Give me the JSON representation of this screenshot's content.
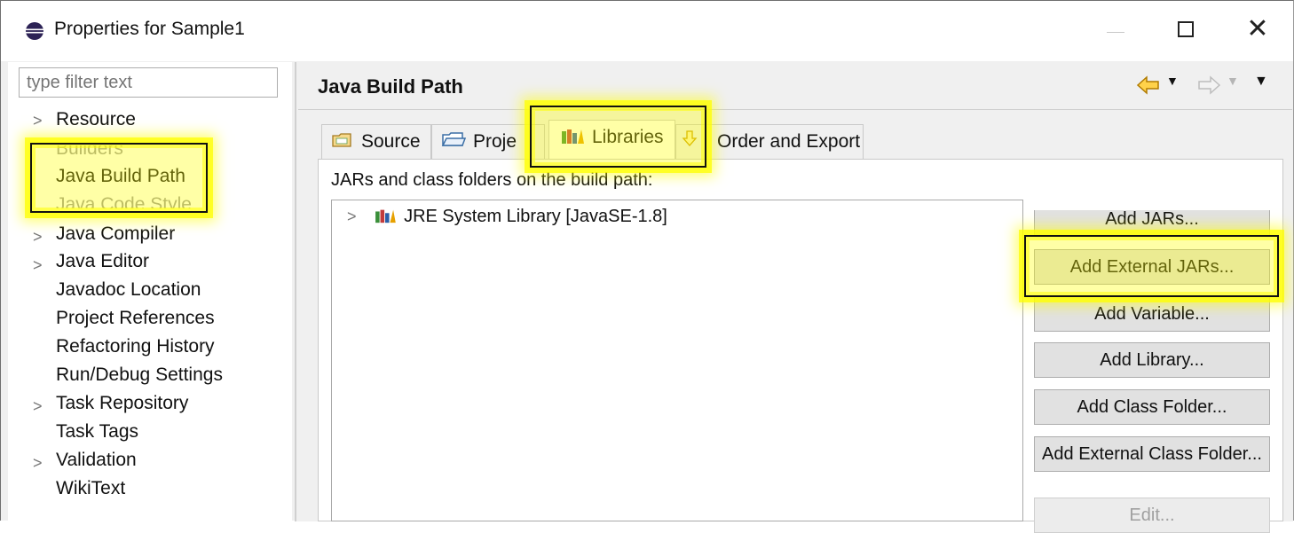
{
  "window": {
    "title": "Properties for Sample1",
    "minimize_icon": "minimize-icon",
    "maximize_icon": "maximize-icon",
    "close_icon": "close-icon",
    "close_glyph": "✕"
  },
  "filter": {
    "placeholder": "type filter text"
  },
  "tree": {
    "items": [
      {
        "label": "Resource",
        "expandable": true
      },
      {
        "label": "Builders",
        "expandable": false,
        "faded": true
      },
      {
        "label": "Java Build Path",
        "expandable": false,
        "selected": true
      },
      {
        "label": "Java Code Style",
        "expandable": true,
        "faded": true
      },
      {
        "label": "Java Compiler",
        "expandable": true
      },
      {
        "label": "Java Editor",
        "expandable": true
      },
      {
        "label": "Javadoc Location",
        "expandable": false
      },
      {
        "label": "Project References",
        "expandable": false
      },
      {
        "label": "Refactoring History",
        "expandable": false
      },
      {
        "label": "Run/Debug Settings",
        "expandable": false
      },
      {
        "label": "Task Repository",
        "expandable": true
      },
      {
        "label": "Task Tags",
        "expandable": false
      },
      {
        "label": "Validation",
        "expandable": true
      },
      {
        "label": "WikiText",
        "expandable": false
      }
    ]
  },
  "page": {
    "title": "Java Build Path"
  },
  "tabs": [
    {
      "label": "Source",
      "icon": "source-folder-icon"
    },
    {
      "label": "Proje",
      "icon": "project-folder-icon"
    },
    {
      "label": "Libraries",
      "icon": "libraries-icon",
      "active": true
    },
    {
      "label": "Order and Export",
      "icon": "order-export-icon"
    }
  ],
  "libraries": {
    "description": "JARs and class folders on the build path:",
    "entries": [
      {
        "label": "JRE System Library [JavaSE-1.8]",
        "icon": "jre-library-icon"
      }
    ]
  },
  "buttons": {
    "add_jars": "Add JARs...",
    "add_external_jars": "Add External JARs...",
    "add_variable": "Add Variable...",
    "add_library": "Add Library...",
    "add_class_folder": "Add Class Folder...",
    "add_external_class_folder": "Add External Class Folder...",
    "edit": "Edit..."
  },
  "colors": {
    "highlight": "#ffff00",
    "window_bg": "#f0f0f0",
    "button_bg": "#e1e1e1"
  }
}
